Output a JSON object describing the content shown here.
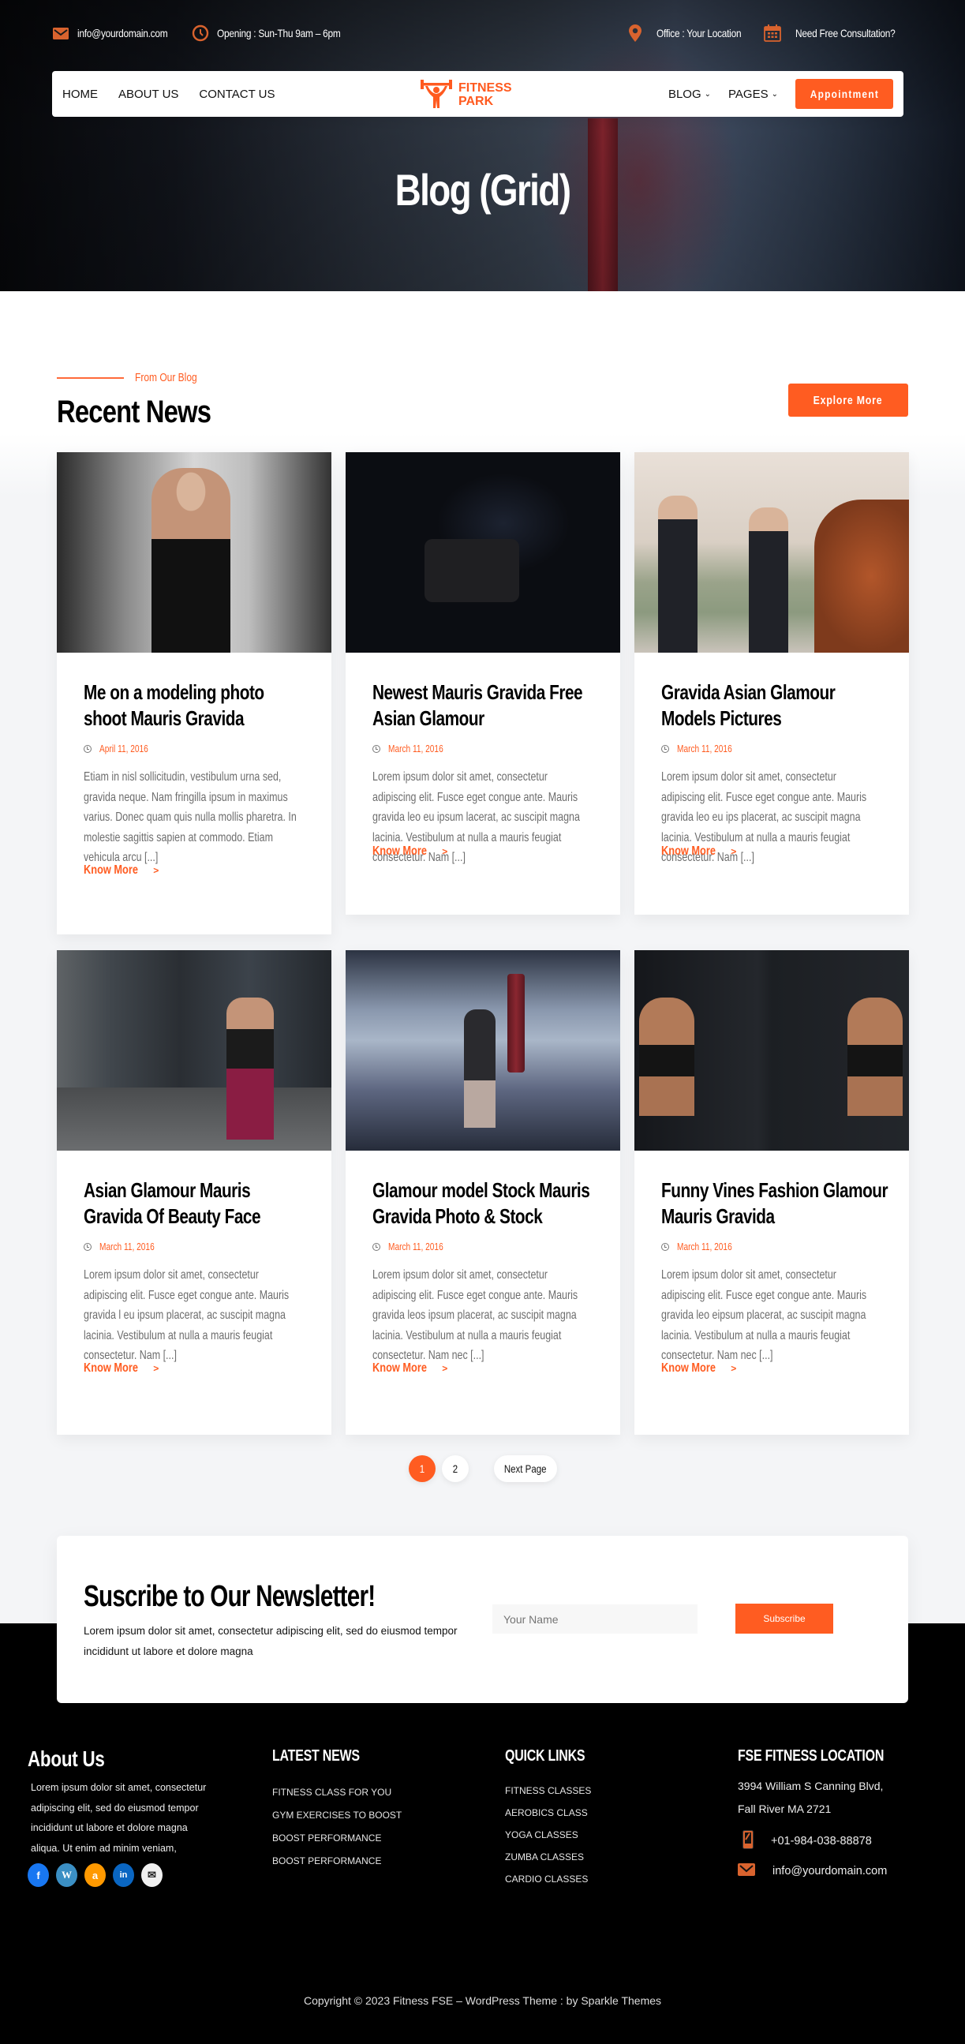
{
  "topbar": {
    "email": "info@yourdomain.com",
    "opening": "Opening : Sun-Thu 9am – 6pm",
    "office": "Office : Your Location",
    "consultation": "Need Free Consultation?"
  },
  "nav": {
    "left": [
      "HOME",
      "ABOUT US",
      "CONTACT US"
    ],
    "logo_line1": "FITNESS",
    "logo_line2": "PARK",
    "right": [
      {
        "label": "BLOG",
        "has_dropdown": true
      },
      {
        "label": "PAGES",
        "has_dropdown": true
      }
    ],
    "cta": "Appointment"
  },
  "hero": {
    "title": "Blog (Grid)"
  },
  "section": {
    "eyebrow": "From Our Blog",
    "title": "Recent News",
    "explore": "Explore More"
  },
  "posts": [
    {
      "title": "Me on a modeling photo shoot Mauris Gravida",
      "date": "April 11, 2016",
      "excerpt": "Etiam in nisl sollicitudin, vestibulum urna sed, gravida neque. Nam fringilla ipsum in maximus varius. Donec  quam quis nulla mollis pharetra. In molestie sagittis sapien at commodo. Etiam vehicula arcu [...]",
      "more": "Know More",
      "image": "woman-on-elliptical-trainer"
    },
    {
      "title": "Newest Mauris Gravida Free Asian Glamour",
      "date": "March 11, 2016",
      "excerpt": "Lorem ipsum dolor sit amet, consectetur adipiscing elit. Fusce eget congue ante. Mauris gravida leo eu ipsum lacerat, ac suscipit magna lacinia. Vestibulum at nulla a mauris feugiat consectetur. Nam [...]",
      "more": "Know More",
      "image": "woman-leg-press"
    },
    {
      "title": "Gravida Asian Glamour Models Pictures",
      "date": "March 11, 2016",
      "excerpt": "Lorem ipsum dolor sit amet, consectetur adipiscing elit.  Fusce eget congue ante.  Mauris gravida leo eu ips placerat, ac suscipit magna lacinia. Vestibulum at nulla a mauris feugiat consectetur. Nam [...]",
      "more": "Know More",
      "image": "two-women-jogging"
    },
    {
      "title": "Asian Glamour Mauris Gravida Of Beauty Face",
      "date": "March 11, 2016",
      "excerpt": "Lorem ipsum dolor sit amet, consectetur adipiscing elit. Fusce eget congue ante. Mauris gravida l eu ipsum placerat, ac suscipit magna lacinia. Vestibulum at nulla a mauris feugiat consectetur. Nam [...]",
      "more": "Know More",
      "image": "woman-battle-ropes"
    },
    {
      "title": "Glamour model Stock Mauris Gravida Photo & Stock",
      "date": "March 11, 2016",
      "excerpt": "Lorem ipsum dolor sit amet, consectetur adipiscing elit. Fusce eget congue ante. Mauris gravida leos ipsum placerat, ac suscipit magna lacinia. Vestibulum at nulla a mauris feugiat consectetur. Nam nec [...]",
      "more": "Know More",
      "image": "woman-kicking-bag"
    },
    {
      "title": "Funny Vines Fashion Glamour Mauris Gravida",
      "date": "March 11, 2016",
      "excerpt": "Lorem ipsum dolor sit amet, consectetur adipiscing elit. Fusce eget congue ante. Mauris gravida leo eipsum placerat, ac suscipit magna lacinia. Vestibulum at nulla a mauris feugiat consectetur. Nam nec [...]",
      "more": "Know More",
      "image": "woman-dumbbells-mirror"
    }
  ],
  "pagination": {
    "pages": [
      "1",
      "2"
    ],
    "current": "1",
    "next": "Next Page"
  },
  "newsletter": {
    "title": "Suscribe to Our Newsletter!",
    "text": "Lorem ipsum dolor sit amet, consectetur adipiscing elit, sed do eiusmod tempor incididunt ut labore et dolore magna",
    "placeholder": "Your Name",
    "button": "Subscribe"
  },
  "footer": {
    "about": {
      "title": "About Us",
      "text": "Lorem ipsum dolor sit amet, consectetur adipiscing elit, sed do eiusmod tempor incididunt ut labore et dolore magna aliqua. Ut enim ad minim veniam,",
      "socials": [
        {
          "name": "facebook",
          "color": "#1877f2",
          "glyph": "f"
        },
        {
          "name": "wordpress",
          "color": "#3b8fc4",
          "glyph": "W"
        },
        {
          "name": "amazon",
          "color": "#ff9900",
          "glyph": "a"
        },
        {
          "name": "linkedin",
          "color": "#0a66c2",
          "glyph": "in"
        },
        {
          "name": "mail",
          "color": "#f0f0f0",
          "glyph": "✉"
        }
      ]
    },
    "latest": {
      "title": "LATEST NEWS",
      "items": [
        "FITNESS CLASS FOR YOU",
        "GYM EXERCISES TO BOOST",
        "BOOST PERFORMANCE",
        "BOOST PERFORMANCE"
      ]
    },
    "quick": {
      "title": "QUICK LINKS",
      "items": [
        "FITNESS CLASSES",
        "AEROBICS CLASS",
        "YOGA CLASSES",
        "ZUMBA CLASSES",
        "CARDIO CLASSES"
      ]
    },
    "location": {
      "title": "FSE FITNESS LOCATION",
      "address_line1": "3994 William S Canning Blvd,",
      "address_line2": "Fall River MA 2721",
      "phone": "+01-984-038-88878",
      "email": "info@yourdomain.com"
    },
    "copyright": "Copyright © 2023 Fitness FSE – WordPress Theme : by Sparkle Themes"
  },
  "colors": {
    "accent": "#ff5c21",
    "footer_bg": "#000000",
    "icon_accent": "#d9632e"
  }
}
